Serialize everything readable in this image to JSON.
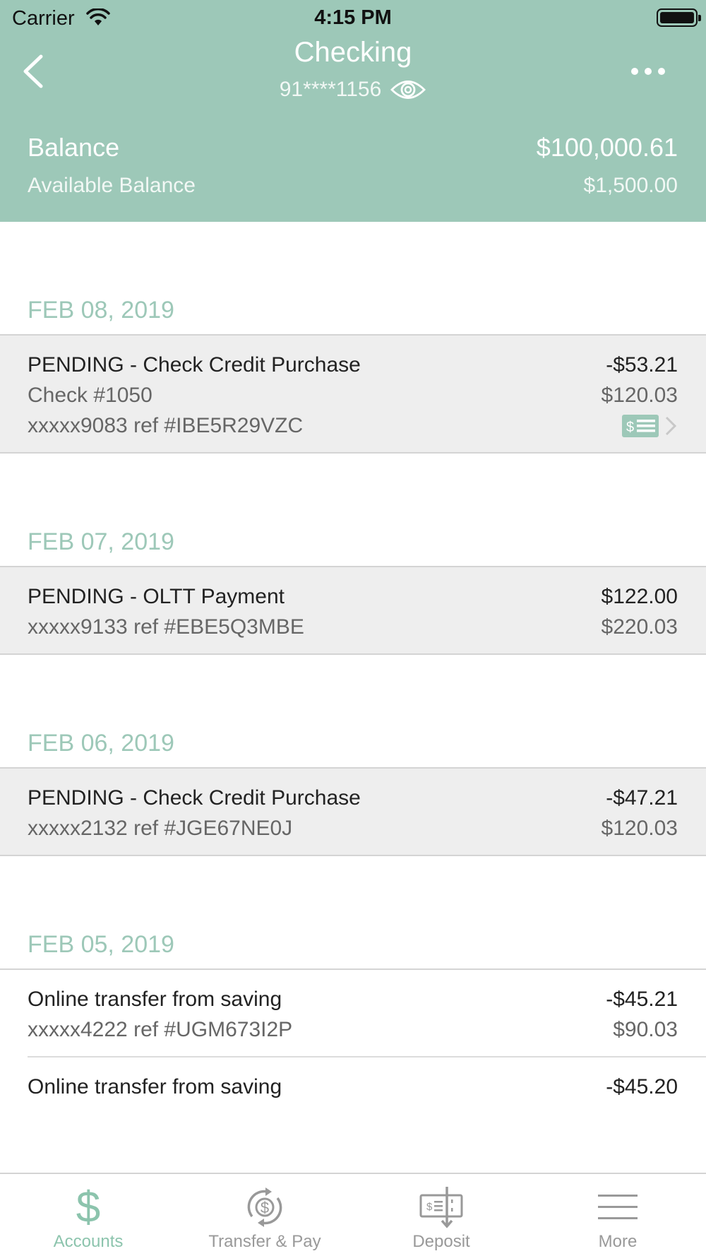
{
  "status_bar": {
    "carrier": "Carrier",
    "time": "4:15 PM"
  },
  "header": {
    "title": "Checking",
    "account_number": "91****1156",
    "balance_label": "Balance",
    "balance_value": "$100,000.61",
    "available_label": "Available Balance",
    "available_value": "$1,500.00"
  },
  "transactions": [
    {
      "date": "FEB 08, 2019",
      "items": [
        {
          "title": "PENDING - Check Credit Purchase",
          "line2": "Check #1050",
          "line3": "xxxxx9083 ref #IBE5R29VZC",
          "amount": "-$53.21",
          "running": "$120.03",
          "has_check": true
        }
      ]
    },
    {
      "date": "FEB 07, 2019",
      "items": [
        {
          "title": "PENDING - OLTT Payment",
          "line2": "xxxxx9133 ref #EBE5Q3MBE",
          "amount": "$122.00",
          "running": "$220.03"
        }
      ]
    },
    {
      "date": "FEB 06, 2019",
      "items": [
        {
          "title": "PENDING - Check Credit Purchase",
          "line2": "xxxxx2132 ref #JGE67NE0J",
          "amount": "-$47.21",
          "running": "$120.03"
        }
      ]
    },
    {
      "date": "FEB 05, 2019",
      "items": [
        {
          "title": "Online transfer from saving",
          "line2": "xxxxx4222 ref #UGM673I2P",
          "amount": "-$45.21",
          "running": "$90.03"
        },
        {
          "title": "Online transfer from saving",
          "amount": "-$45.20"
        }
      ]
    }
  ],
  "tabs": [
    {
      "label": "Accounts",
      "icon": "dollar-icon",
      "active": true
    },
    {
      "label": "Transfer & Pay",
      "icon": "transfer-pay-icon",
      "active": false
    },
    {
      "label": "Deposit",
      "icon": "deposit-check-icon",
      "active": false
    },
    {
      "label": "More",
      "icon": "hamburger-menu-icon",
      "active": false
    }
  ],
  "colors": {
    "accent": "#9dc8b8",
    "active_tab": "#8cc4ad",
    "row_bg": "#eeeeee"
  }
}
